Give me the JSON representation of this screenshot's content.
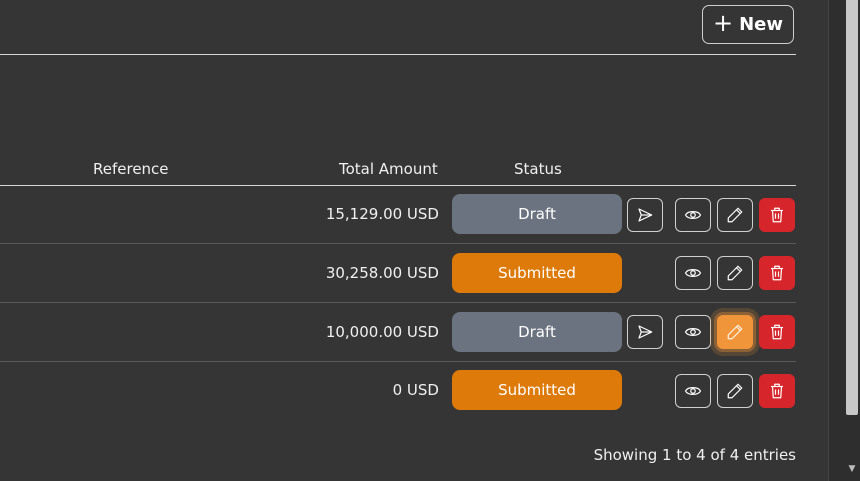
{
  "header": {
    "new_label": "New"
  },
  "table": {
    "columns": [
      "Reference",
      "Total Amount",
      "Status"
    ],
    "rows": [
      {
        "amount": "15,129.00 USD",
        "status": "Draft",
        "actions": [
          "send",
          "view",
          "edit",
          "delete"
        ]
      },
      {
        "amount": "30,258.00 USD",
        "status": "Submitted",
        "actions": [
          "view",
          "edit",
          "delete"
        ]
      },
      {
        "amount": "10,000.00 USD",
        "status": "Draft",
        "actions": [
          "send",
          "view",
          "edit",
          "delete"
        ]
      },
      {
        "amount": "0 USD",
        "status": "Submitted",
        "actions": [
          "view",
          "edit",
          "delete"
        ]
      }
    ]
  },
  "footer": {
    "entries_text": "Showing 1 to 4 of 4 entries"
  },
  "colors": {
    "draft": "#6c7380",
    "submitted": "#dd7a0a",
    "delete": "#d6262b",
    "highlight": "#f0953a"
  },
  "icons": {
    "new": "plus-icon",
    "send": "send-icon",
    "view": "eye-icon",
    "edit": "pencil-icon",
    "delete": "trash-icon"
  }
}
